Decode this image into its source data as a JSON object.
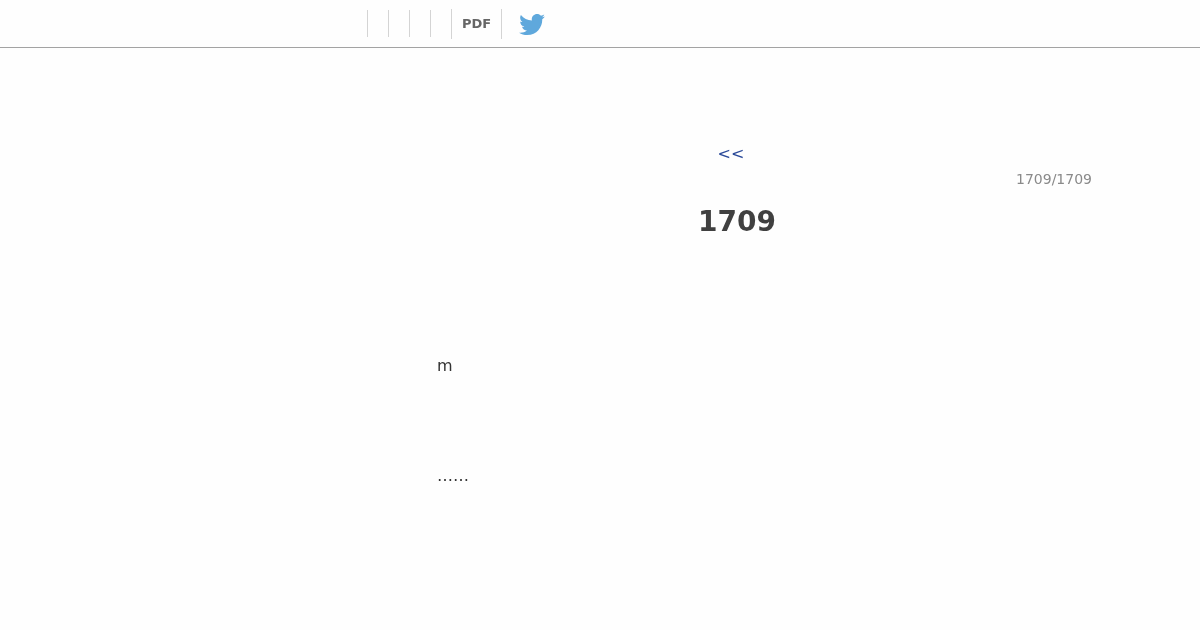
{
  "nav": {
    "links": [
      {
        "kind": "text",
        "label": "PDF"
      },
      {
        "kind": "twitter"
      }
    ]
  },
  "page": {
    "back_link": "<<",
    "counter": "1709/1709",
    "title": "1709",
    "paragraphs": [
      "m",
      "……"
    ]
  }
}
